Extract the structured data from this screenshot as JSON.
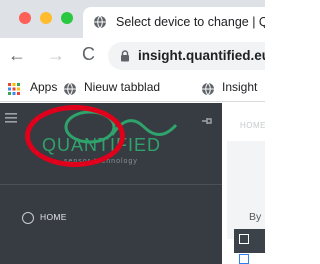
{
  "browser": {
    "tab": {
      "title": "Select device to change | Quantified",
      "favicon": "globe-icon"
    },
    "toolbar": {
      "back_icon": "←",
      "forward_icon": "→",
      "reload_icon": "C",
      "url": "insight.quantified.eu"
    },
    "bookmarks": {
      "apps_label": "Apps",
      "items": [
        {
          "label": "Nieuw tabblad",
          "icon": "globe-icon"
        },
        {
          "label": "Insight",
          "icon": "globe-icon"
        }
      ]
    }
  },
  "sidebar": {
    "logo_text": "QUANTIFIED",
    "logo_tagline": "sensor technology",
    "nav_items": [
      {
        "label": "HOME",
        "icon": "circle-icon"
      }
    ]
  },
  "main": {
    "breadcrumb": "HOME",
    "filter_label": "By"
  },
  "colors": {
    "sidebar_bg": "#363c42",
    "logo_green": "#2fa36b",
    "highlight_red": "#e0001b",
    "checkbox_blue": "#2f80ed"
  }
}
